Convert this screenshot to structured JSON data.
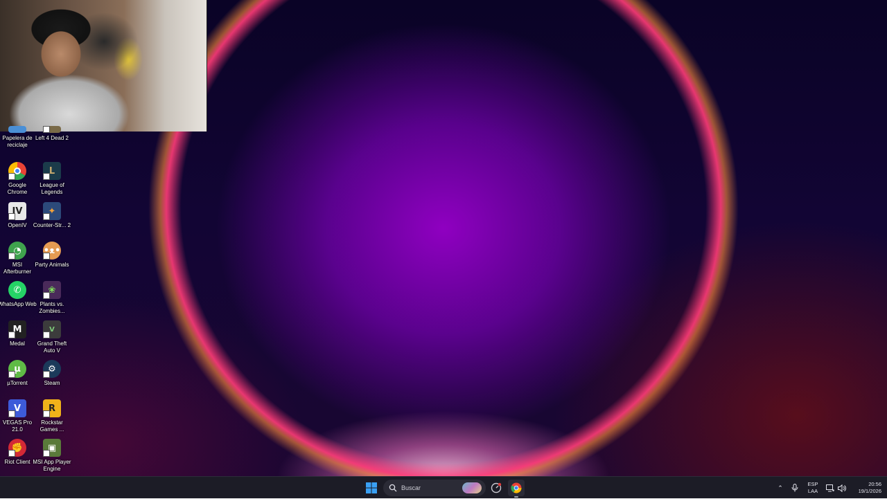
{
  "desktop": {
    "icons": [
      {
        "label": "Papelera de reciclaje",
        "icon": "recycle-bin-icon",
        "color": "#4a8fd6"
      },
      {
        "label": "Left 4 Dead 2",
        "icon": "left4dead2-icon",
        "color": "#7a6a48"
      },
      {
        "label": "Google Chrome",
        "icon": "chrome-icon",
        "color": "#dd4437"
      },
      {
        "label": "League of Legends",
        "icon": "league-of-legends-icon",
        "color": "#1b3b4a"
      },
      {
        "label": "OpenIV",
        "icon": "openiv-icon",
        "color": "#e8e8e8"
      },
      {
        "label": "Counter-Str... 2",
        "icon": "counter-strike-icon",
        "color": "#2c4a7a"
      },
      {
        "label": "MSI Afterburner",
        "icon": "msi-afterburner-icon",
        "color": "#3fa34d"
      },
      {
        "label": "Party Animals",
        "icon": "party-animals-icon",
        "color": "#e59b52"
      },
      {
        "label": "WhatsApp Web",
        "icon": "whatsapp-icon",
        "color": "#25d366"
      },
      {
        "label": "Plants vs. Zombies...",
        "icon": "plants-vs-zombies-icon",
        "color": "#4a2a5a"
      },
      {
        "label": "Medal",
        "icon": "medal-icon",
        "color": "#222222"
      },
      {
        "label": "Grand Theft Auto V",
        "icon": "gta-v-icon",
        "color": "#3c3c3c"
      },
      {
        "label": "µTorrent",
        "icon": "utorrent-icon",
        "color": "#5fbb46"
      },
      {
        "label": "Steam",
        "icon": "steam-icon",
        "color": "#1b3a5a"
      },
      {
        "label": "VEGAS Pro 21.0",
        "icon": "vegas-pro-icon",
        "color": "#3d5bd9"
      },
      {
        "label": "Rockstar Games ...",
        "icon": "rockstar-games-icon",
        "color": "#f0b21a"
      },
      {
        "label": "Riot Client",
        "icon": "riot-client-icon",
        "color": "#d32936"
      },
      {
        "label": "MSI App Player Engine",
        "icon": "msi-app-player-icon",
        "color": "#5a7a3a"
      }
    ]
  },
  "taskbar": {
    "search_placeholder": "Buscar",
    "language_top": "ESP",
    "language_bottom": "LAA",
    "time": "20:56",
    "date": "19/1/2026"
  },
  "colors": {
    "taskbar_bg": "#1c1c26",
    "start_blue": "#3aa0f3"
  }
}
